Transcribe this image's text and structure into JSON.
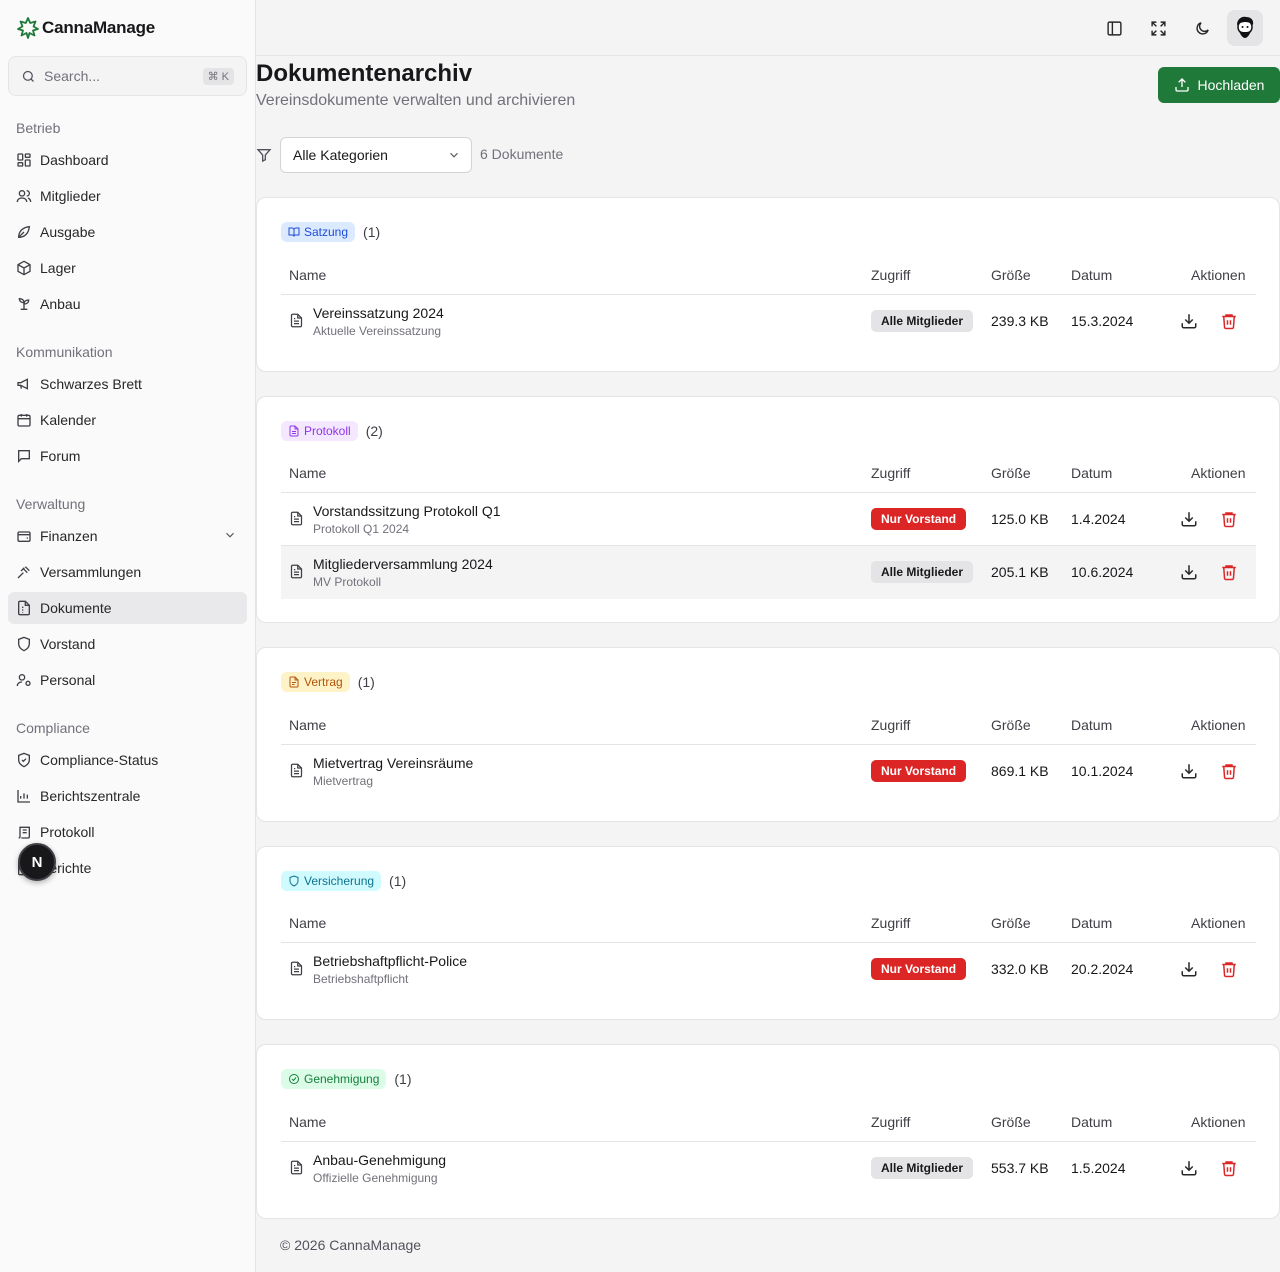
{
  "brand": {
    "name": "CannaManage"
  },
  "search": {
    "placeholder": "Search...",
    "shortcut": "⌘ K"
  },
  "sidebar": {
    "groups": [
      {
        "label": "Betrieb"
      },
      {
        "label": "Kommunikation"
      },
      {
        "label": "Verwaltung"
      },
      {
        "label": "Compliance"
      }
    ],
    "items": [
      {
        "label": "Dashboard",
        "icon": "layout-dashboard-icon"
      },
      {
        "label": "Mitglieder",
        "icon": "users-icon"
      },
      {
        "label": "Ausgabe",
        "icon": "leaf-icon"
      },
      {
        "label": "Lager",
        "icon": "package-icon"
      },
      {
        "label": "Anbau",
        "icon": "sprout-icon"
      },
      {
        "label": "Schwarzes Brett",
        "icon": "megaphone-icon"
      },
      {
        "label": "Kalender",
        "icon": "calendar-icon"
      },
      {
        "label": "Forum",
        "icon": "message-square-icon"
      },
      {
        "label": "Finanzen",
        "icon": "wallet-icon"
      },
      {
        "label": "Versammlungen",
        "icon": "gavel-icon"
      },
      {
        "label": "Dokumente",
        "icon": "file-archive-icon"
      },
      {
        "label": "Vorstand",
        "icon": "shield-icon"
      },
      {
        "label": "Personal",
        "icon": "user-cog-icon"
      },
      {
        "label": "Compliance-Status",
        "icon": "shield-check-icon"
      },
      {
        "label": "Berichtszentrale",
        "icon": "bar-chart-icon"
      },
      {
        "label": "Protokoll",
        "icon": "scroll-icon"
      },
      {
        "label": "Berichte",
        "icon": "file-chart-icon"
      }
    ]
  },
  "header": {
    "title": "Dokumentenarchiv",
    "subtitle": "Vereinsdokumente verwalten und archivieren",
    "upload_label": "Hochladen"
  },
  "filter": {
    "selected": "Alle Kategorien",
    "count_text": "6 Dokumente"
  },
  "table_headers": {
    "name": "Name",
    "access": "Zugriff",
    "size": "Größe",
    "date": "Datum",
    "actions": "Aktionen"
  },
  "categories": [
    {
      "label": "Satzung",
      "count": "(1)",
      "color": "#1d4ed8",
      "bg": "#dbeafe",
      "icon": "book-open-icon",
      "docs": [
        {
          "name": "Vereinssatzung 2024",
          "desc": "Aktuelle Vereinssatzung",
          "access": "Alle Mitglieder",
          "size": "239.3 KB",
          "date": "15.3.2024"
        }
      ]
    },
    {
      "label": "Protokoll",
      "count": "(2)",
      "color": "#9333ea",
      "bg": "#f3e8ff",
      "icon": "file-text-icon",
      "docs": [
        {
          "name": "Vorstandssitzung Protokoll Q1",
          "desc": "Protokoll Q1 2024",
          "access": "Nur Vorstand",
          "size": "125.0 KB",
          "date": "1.4.2024"
        },
        {
          "name": "Mitgliederversammlung 2024",
          "desc": "MV Protokoll",
          "access": "Alle Mitglieder",
          "size": "205.1 KB",
          "date": "10.6.2024"
        }
      ]
    },
    {
      "label": "Vertrag",
      "count": "(1)",
      "color": "#b45309",
      "bg": "#fef3c7",
      "icon": "file-signature-icon",
      "docs": [
        {
          "name": "Mietvertrag Vereinsräume",
          "desc": "Mietvertrag",
          "access": "Nur Vorstand",
          "size": "869.1 KB",
          "date": "10.1.2024"
        }
      ]
    },
    {
      "label": "Versicherung",
      "count": "(1)",
      "color": "#0e7490",
      "bg": "#cffafe",
      "icon": "shield-icon",
      "docs": [
        {
          "name": "Betriebshaftpflicht-Police",
          "desc": "Betriebshaftpflicht",
          "access": "Nur Vorstand",
          "size": "332.0 KB",
          "date": "20.2.2024"
        }
      ]
    },
    {
      "label": "Genehmigung",
      "count": "(1)",
      "color": "#15803d",
      "bg": "#dcfce7",
      "icon": "circle-check-icon",
      "docs": [
        {
          "name": "Anbau-Genehmigung",
          "desc": "Offizielle Genehmigung",
          "access": "Alle Mitglieder",
          "size": "553.7 KB",
          "date": "1.5.2024"
        }
      ]
    }
  ],
  "footer": {
    "text": "© 2026 CannaManage"
  },
  "floating": {
    "label": "N"
  }
}
